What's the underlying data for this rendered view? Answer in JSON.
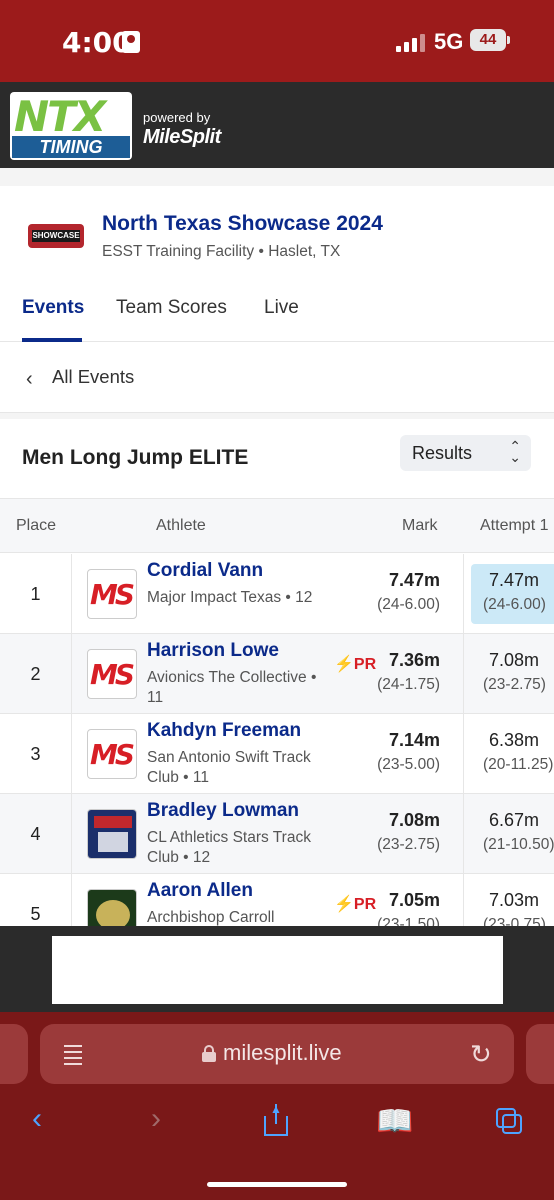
{
  "status": {
    "time": "4:00",
    "network": "5G",
    "battery": "44"
  },
  "header": {
    "logo_top": "NTX",
    "logo_bottom": "TIMING",
    "powered_by": "powered by",
    "brand": "MileSplit"
  },
  "meet": {
    "logo_text": "SHOWCASE",
    "title": "North Texas Showcase 2024",
    "subtitle": "ESST Training Facility • Haslet, TX"
  },
  "tabs": [
    {
      "label": "Events",
      "active": true
    },
    {
      "label": "Team Scores",
      "active": false
    },
    {
      "label": "Live",
      "active": false
    }
  ],
  "back_link": {
    "label": "All Events"
  },
  "event": {
    "title": "Men Long Jump ELITE",
    "view_select": "Results"
  },
  "table": {
    "columns": {
      "place": "Place",
      "athlete": "Athlete",
      "mark": "Mark",
      "attempt1": "Attempt 1"
    },
    "rows": [
      {
        "place": "1",
        "logo": "MS",
        "name": "Cordial Vann",
        "team": "Major Impact Texas • 12",
        "pr": "",
        "mark": "7.47m",
        "mark_imperial": "(24-6.00)",
        "att1": "7.47m",
        "att1_imperial": "(24-6.00)",
        "att1_best": true
      },
      {
        "place": "2",
        "logo": "MS",
        "name": "Harrison Lowe",
        "team": "Avionics The Collective • 11",
        "pr": "⚡PR",
        "mark": "7.36m",
        "mark_imperial": "(24-1.75)",
        "att1": "7.08m",
        "att1_imperial": "(23-2.75)",
        "att1_best": false
      },
      {
        "place": "3",
        "logo": "MS",
        "name": "Kahdyn Freeman",
        "team": "San Antonio Swift Track Club • 11",
        "pr": "",
        "mark": "7.14m",
        "mark_imperial": "(23-5.00)",
        "att1": "6.38m",
        "att1_imperial": "(20-11.25)",
        "att1_best": false
      },
      {
        "place": "4",
        "logo": "stars",
        "name": "Bradley Lowman",
        "team": "CL Athletics Stars Track Club • 12",
        "pr": "",
        "mark": "7.08m",
        "mark_imperial": "(23-2.75)",
        "att1": "6.67m",
        "att1_imperial": "(21-10.50)",
        "att1_best": false
      },
      {
        "place": "5",
        "logo": "gecko",
        "name": "Aaron Allen",
        "team": "Archbishop Carroll",
        "pr": "⚡PR",
        "mark": "7.05m",
        "mark_imperial": "(23-1.50)",
        "att1": "7.03m",
        "att1_imperial": "(23-0.75)",
        "att1_best": false
      }
    ]
  },
  "browser": {
    "url": "milesplit.live"
  },
  "colors": {
    "status_bar": "#9c1b1b",
    "navy": "#0b2a8a",
    "pr_red": "#d71f26",
    "best_attempt": "#cce9f7",
    "browser_bar": "#7a1818",
    "ios_blue": "#4ea3ff"
  }
}
